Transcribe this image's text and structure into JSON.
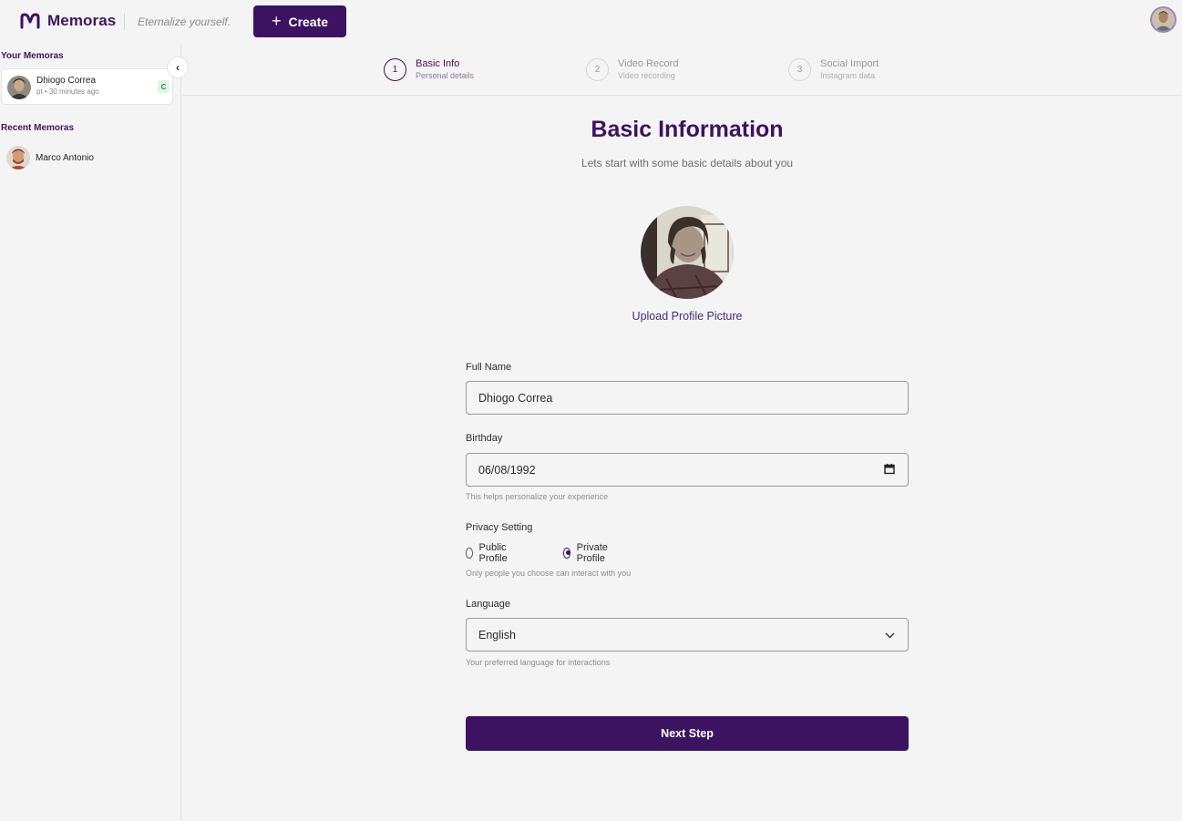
{
  "header": {
    "brand": "Memoras",
    "tagline": "Eternalize yourself.",
    "create_label": "Create"
  },
  "sidebar": {
    "your_heading": "Your Memoras",
    "your_items": [
      {
        "name": "Dhiogo Correa",
        "meta": "pt • 30 minutes ago",
        "badge": "C"
      }
    ],
    "recent_heading": "Recent Memoras",
    "recent_items": [
      {
        "name": "Marco Antonio"
      }
    ]
  },
  "stepper": {
    "steps": [
      {
        "number": "1",
        "title": "Basic Info",
        "subtitle": "Personal details",
        "active": true
      },
      {
        "number": "2",
        "title": "Video Record",
        "subtitle": "Video recording",
        "active": false
      },
      {
        "number": "3",
        "title": "Social Import",
        "subtitle": "Instagram data",
        "active": false
      }
    ]
  },
  "form": {
    "title": "Basic Information",
    "subtitle": "Lets start with some basic details about you",
    "upload_label": "Upload Profile Picture",
    "full_name": {
      "label": "Full Name",
      "value": "Dhiogo Correa"
    },
    "birthday": {
      "label": "Birthday",
      "value": "06/08/1992",
      "help": "This helps personalize your experience"
    },
    "privacy": {
      "label": "Privacy Setting",
      "options": [
        "Public Profile",
        "Private Profile"
      ],
      "selected": "Private Profile",
      "help": "Only people you choose can interact with you"
    },
    "language": {
      "label": "Language",
      "value": "English",
      "help": "Your preferred language for interactions"
    },
    "next_label": "Next Step"
  },
  "colors": {
    "brand": "#3c1361",
    "background": "#f4f4f4",
    "badge_bg": "#dff5e4",
    "badge_fg": "#2e8a4a"
  },
  "icons": [
    "memoras-logo-icon",
    "plus-icon",
    "chevron-left-icon",
    "calendar-icon",
    "chevron-down-icon"
  ]
}
